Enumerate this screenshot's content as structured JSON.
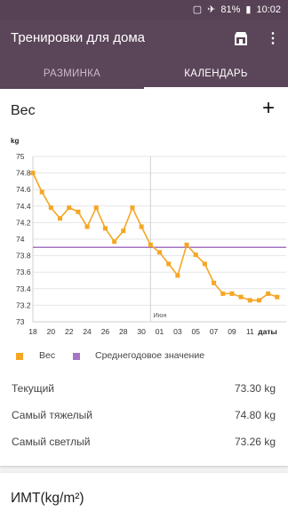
{
  "status_bar": {
    "battery": "81%",
    "time": "10:02"
  },
  "toolbar": {
    "title": "Тренировки для дома",
    "store_icon": "store-icon",
    "more_icon": "more-vert-icon"
  },
  "tabs": [
    {
      "label": "РАЗМИНКА",
      "active": false
    },
    {
      "label": "КАЛЕНДАРЬ",
      "active": true
    }
  ],
  "weight_card": {
    "title": "Вес",
    "add_label": "+",
    "legend": [
      {
        "label": "Вес",
        "color": "#f5a623"
      },
      {
        "label": "Среднегодовое значение",
        "color": "#a575c4"
      }
    ],
    "stats": [
      {
        "label": "Текущий",
        "value": "73.30 kg"
      },
      {
        "label": "Самый тяжелый",
        "value": "74.80 kg"
      },
      {
        "label": "Самый светлый",
        "value": "73.26 kg"
      }
    ]
  },
  "bmi_card": {
    "title": "ИМТ(kg/m²)"
  },
  "chart_data": {
    "type": "line",
    "ylabel": "kg",
    "xlabel": "даты",
    "ylim": [
      73,
      75
    ],
    "yticks": [
      "75",
      "74.8",
      "74.6",
      "74.4",
      "74.2",
      "74",
      "73.8",
      "73.6",
      "73.4",
      "73.2",
      "73"
    ],
    "xticks": [
      "18",
      "20",
      "22",
      "24",
      "26",
      "28",
      "30",
      "01",
      "03",
      "05",
      "07",
      "09",
      "11"
    ],
    "month_label": "Июн",
    "average": 73.9,
    "series": [
      {
        "name": "Вес",
        "color": "#f5a623",
        "x": [
          18,
          19,
          20,
          21,
          22,
          23,
          24,
          25,
          26,
          27,
          28,
          29,
          30,
          31,
          32,
          33,
          34,
          35,
          36,
          37,
          38,
          39,
          40,
          41,
          42,
          43,
          44,
          45
        ],
        "y": [
          74.8,
          74.57,
          74.38,
          74.25,
          74.38,
          74.33,
          74.15,
          74.38,
          74.13,
          73.97,
          74.1,
          74.38,
          74.15,
          73.93,
          73.84,
          73.7,
          73.56,
          73.93,
          73.81,
          73.7,
          73.47,
          73.34,
          73.34,
          73.3,
          73.26,
          73.26,
          73.34,
          73.3
        ]
      },
      {
        "name": "Среднегодовое значение",
        "color": "#a575c4"
      }
    ]
  }
}
